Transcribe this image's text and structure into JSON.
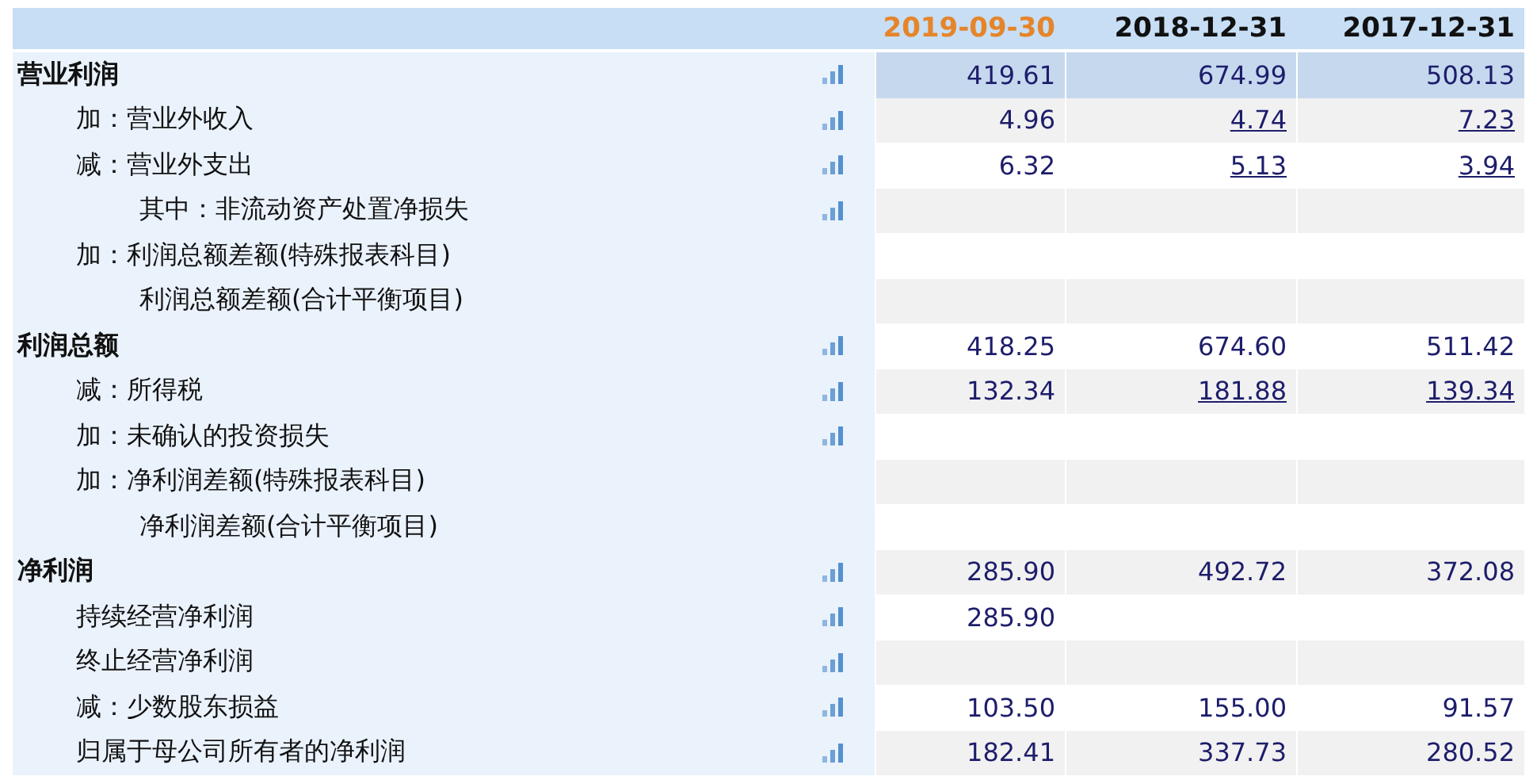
{
  "columns": [
    {
      "label": "2019-09-30",
      "selected": true
    },
    {
      "label": "2018-12-31",
      "selected": false
    },
    {
      "label": "2017-12-31",
      "selected": false
    }
  ],
  "rows": [
    {
      "label": "营业利润",
      "kind": "heading",
      "chart": true,
      "selected": true,
      "values": [
        {
          "text": "419.61",
          "link": false
        },
        {
          "text": "674.99",
          "link": false
        },
        {
          "text": "508.13",
          "link": false
        }
      ]
    },
    {
      "label": "加：营业外收入",
      "kind": "item",
      "chart": true,
      "selected": false,
      "values": [
        {
          "text": "4.96",
          "link": false
        },
        {
          "text": "4.74",
          "link": true
        },
        {
          "text": "7.23",
          "link": true
        }
      ]
    },
    {
      "label": "减：营业外支出",
      "kind": "item",
      "chart": true,
      "selected": false,
      "values": [
        {
          "text": "6.32",
          "link": false
        },
        {
          "text": "5.13",
          "link": true
        },
        {
          "text": "3.94",
          "link": true
        }
      ]
    },
    {
      "label": "其中：非流动资产处置净损失",
      "kind": "sub",
      "chart": true,
      "selected": false,
      "values": []
    },
    {
      "label": "加：利润总额差额(特殊报表科目)",
      "kind": "item",
      "chart": false,
      "selected": false,
      "values": []
    },
    {
      "label": "利润总额差额(合计平衡项目)",
      "kind": "sub",
      "chart": false,
      "selected": false,
      "values": []
    },
    {
      "label": "利润总额",
      "kind": "heading",
      "chart": true,
      "selected": false,
      "values": [
        {
          "text": "418.25",
          "link": false
        },
        {
          "text": "674.60",
          "link": false
        },
        {
          "text": "511.42",
          "link": false
        }
      ]
    },
    {
      "label": "减：所得税",
      "kind": "item",
      "chart": true,
      "selected": false,
      "values": [
        {
          "text": "132.34",
          "link": false
        },
        {
          "text": "181.88",
          "link": true
        },
        {
          "text": "139.34",
          "link": true
        }
      ]
    },
    {
      "label": "加：未确认的投资损失",
      "kind": "item",
      "chart": true,
      "selected": false,
      "values": []
    },
    {
      "label": "加：净利润差额(特殊报表科目)",
      "kind": "item",
      "chart": false,
      "selected": false,
      "values": []
    },
    {
      "label": "净利润差额(合计平衡项目)",
      "kind": "sub",
      "chart": false,
      "selected": false,
      "values": []
    },
    {
      "label": "净利润",
      "kind": "heading",
      "chart": true,
      "selected": false,
      "values": [
        {
          "text": "285.90",
          "link": false
        },
        {
          "text": "492.72",
          "link": false
        },
        {
          "text": "372.08",
          "link": false
        }
      ]
    },
    {
      "label": "持续经营净利润",
      "kind": "item",
      "chart": true,
      "selected": false,
      "values": [
        {
          "text": "285.90",
          "link": false
        }
      ]
    },
    {
      "label": "终止经营净利润",
      "kind": "item",
      "chart": true,
      "selected": false,
      "values": []
    },
    {
      "label": "减：少数股东损益",
      "kind": "item",
      "chart": true,
      "selected": false,
      "values": [
        {
          "text": "103.50",
          "link": false
        },
        {
          "text": "155.00",
          "link": false
        },
        {
          "text": "91.57",
          "link": false
        }
      ]
    },
    {
      "label": "归属于母公司所有者的净利润",
      "kind": "item",
      "chart": true,
      "selected": false,
      "values": [
        {
          "text": "182.41",
          "link": false
        },
        {
          "text": "337.73",
          "link": false
        },
        {
          "text": "280.52",
          "link": false
        }
      ]
    }
  ]
}
